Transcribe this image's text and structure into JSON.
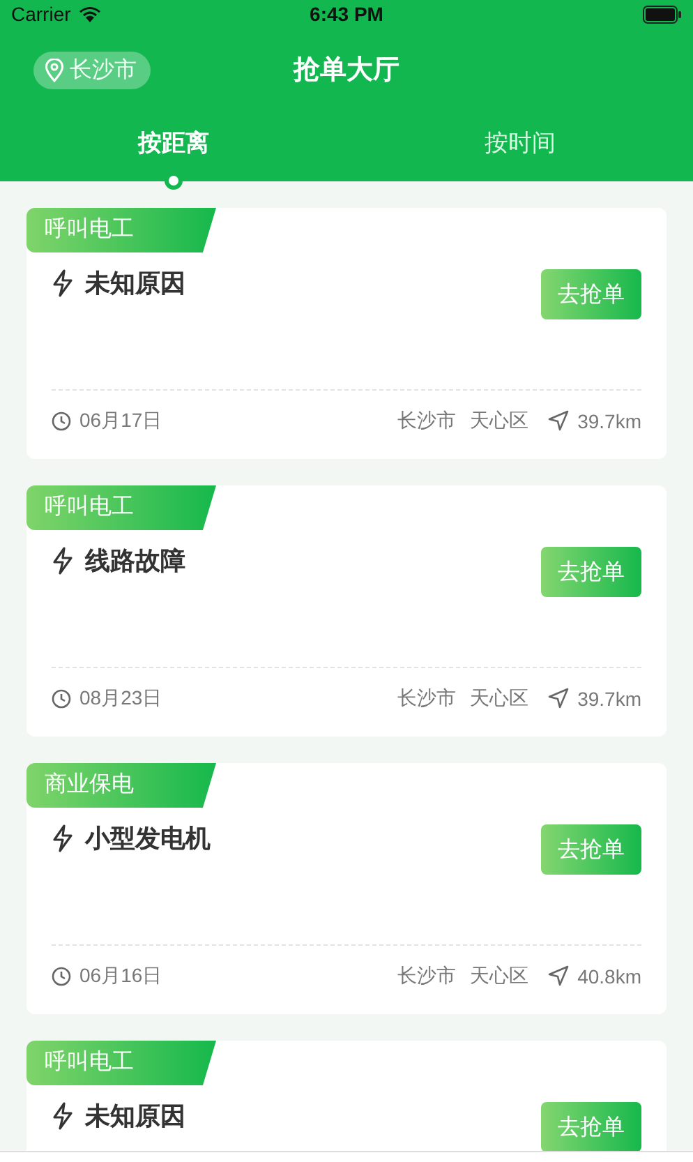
{
  "status_bar": {
    "carrier": "Carrier",
    "time": "6:43 PM"
  },
  "header": {
    "location": "长沙市",
    "title": "抢单大厅"
  },
  "tabs": [
    {
      "label": "按距离",
      "selected": true
    },
    {
      "label": "按时间",
      "selected": false
    }
  ],
  "orders": [
    {
      "category": "呼叫电工",
      "title": "未知原因",
      "button": "去抢单",
      "date": "06月17日",
      "city": "长沙市",
      "district": "天心区",
      "distance": "39.7km"
    },
    {
      "category": "呼叫电工",
      "title": "线路故障",
      "button": "去抢单",
      "date": "08月23日",
      "city": "长沙市",
      "district": "天心区",
      "distance": "39.7km"
    },
    {
      "category": "商业保电",
      "title": "小型发电机",
      "button": "去抢单",
      "date": "06月16日",
      "city": "长沙市",
      "district": "天心区",
      "distance": "40.8km"
    },
    {
      "category": "呼叫电工",
      "title": "未知原因",
      "button": "去抢单"
    }
  ]
}
